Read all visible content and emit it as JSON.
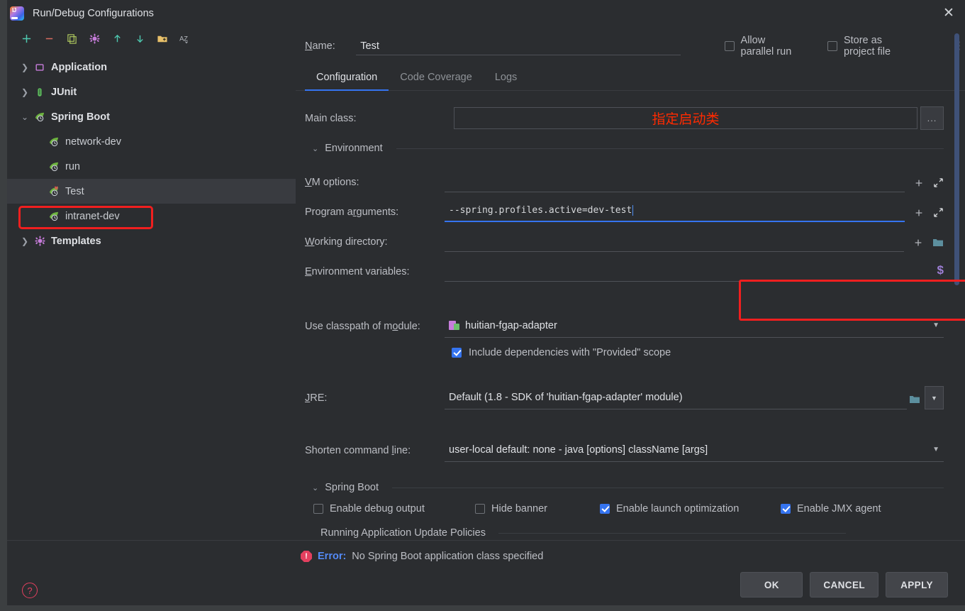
{
  "window": {
    "title": "Run/Debug Configurations",
    "app_icon": "intellij-idea-icon",
    "close_label": "✕"
  },
  "toolbar": {
    "items": [
      {
        "name": "add-configuration-button",
        "glyph": "+",
        "color": "#4ec9b0"
      },
      {
        "name": "remove-configuration-button",
        "glyph": "−",
        "color": "#d96a5f"
      },
      {
        "name": "copy-configuration-button",
        "glyph": "❐",
        "color": "#b4cf60"
      },
      {
        "name": "edit-templates-button",
        "glyph": "✹",
        "color": "#c77ddb"
      },
      {
        "name": "move-up-button",
        "glyph": "↑",
        "color": "#4ec9b0"
      },
      {
        "name": "move-down-button",
        "glyph": "↓",
        "color": "#4ec9b0"
      },
      {
        "name": "new-folder-button",
        "glyph": "🗀",
        "color": "#e8c06a"
      },
      {
        "name": "sort-alphabetically-button",
        "glyph": "ÂZ",
        "color": "#b8bcc2"
      }
    ]
  },
  "tree": {
    "items": [
      {
        "label": "Application",
        "level": 0,
        "expanded": false,
        "icon": "application-icon",
        "selected": false
      },
      {
        "label": "JUnit",
        "level": 0,
        "expanded": false,
        "icon": "junit-icon",
        "selected": false
      },
      {
        "label": "Spring Boot",
        "level": 0,
        "expanded": true,
        "icon": "spring-boot-icon",
        "selected": false
      },
      {
        "label": "network-dev",
        "level": 1,
        "expanded": null,
        "icon": "spring-boot-icon",
        "selected": false
      },
      {
        "label": "run",
        "level": 1,
        "expanded": null,
        "icon": "spring-boot-icon",
        "selected": false
      },
      {
        "label": "Test",
        "level": 1,
        "expanded": null,
        "icon": "spring-boot-error-icon",
        "selected": true
      },
      {
        "label": "intranet-dev",
        "level": 1,
        "expanded": null,
        "icon": "spring-boot-icon",
        "selected": false
      },
      {
        "label": "Templates",
        "level": 0,
        "expanded": false,
        "icon": "templates-gear-icon",
        "selected": false
      }
    ]
  },
  "header": {
    "name_label": "Name:",
    "name_value": "Test",
    "allow_parallel_run": {
      "label": "Allow parallel run",
      "checked": false
    },
    "store_as_project_file": {
      "label": "Store as project file",
      "checked": false
    },
    "overflow_menu": "⋮"
  },
  "tabs": [
    {
      "label": "Configuration",
      "active": true
    },
    {
      "label": "Code Coverage",
      "active": false
    },
    {
      "label": "Logs",
      "active": false
    }
  ],
  "configuration": {
    "main_class": {
      "label": "Main class:",
      "value": "",
      "annotation": "指定启动类",
      "browse_button": "..."
    },
    "environment_section": {
      "label": "Environment",
      "expanded": true
    },
    "vm_options": {
      "label": "VM options:",
      "value": ""
    },
    "program_arguments": {
      "label": "Program arguments:",
      "value": "--spring.profiles.active=dev-test",
      "focused": true,
      "highlighted": true
    },
    "working_directory": {
      "label": "Working directory:",
      "value": ""
    },
    "environment_variables": {
      "label": "Environment variables:",
      "value": "",
      "macro_icon": "$"
    },
    "use_classpath_of_module": {
      "label": "Use classpath of module:",
      "value": "huitian-fgap-adapter"
    },
    "include_provided_scope": {
      "label": "Include dependencies with \"Provided\" scope",
      "checked": true
    },
    "jre": {
      "label": "JRE:",
      "value": "Default (1.8 - SDK of 'huitian-fgap-adapter' module)"
    },
    "shorten_command_line": {
      "label": "Shorten command line:",
      "value": "user-local default: none - java [options] className [args]"
    },
    "spring_boot_section": {
      "label": "Spring Boot",
      "expanded": true
    },
    "spring_boot_checks": [
      {
        "label": "Enable debug output",
        "checked": false
      },
      {
        "label": "Hide banner",
        "checked": false
      },
      {
        "label": "Enable launch optimization",
        "checked": true
      },
      {
        "label": "Enable JMX agent",
        "checked": true
      }
    ],
    "running_app_update_policies": {
      "label": "Running Application Update Policies"
    }
  },
  "footer": {
    "error_prefix": "Error:",
    "error_message": "No Spring Boot application class specified",
    "buttons": [
      {
        "label": "OK",
        "name": "ok-button"
      },
      {
        "label": "CANCEL",
        "name": "cancel-button"
      },
      {
        "label": "APPLY",
        "name": "apply-button"
      }
    ],
    "help_glyph": "?"
  },
  "colors": {
    "accent": "#3574f0",
    "annotation_red": "#ff2a00",
    "highlight_box": "#f01f1f",
    "error_blue": "#548af7",
    "bg": "#2b2d30"
  }
}
